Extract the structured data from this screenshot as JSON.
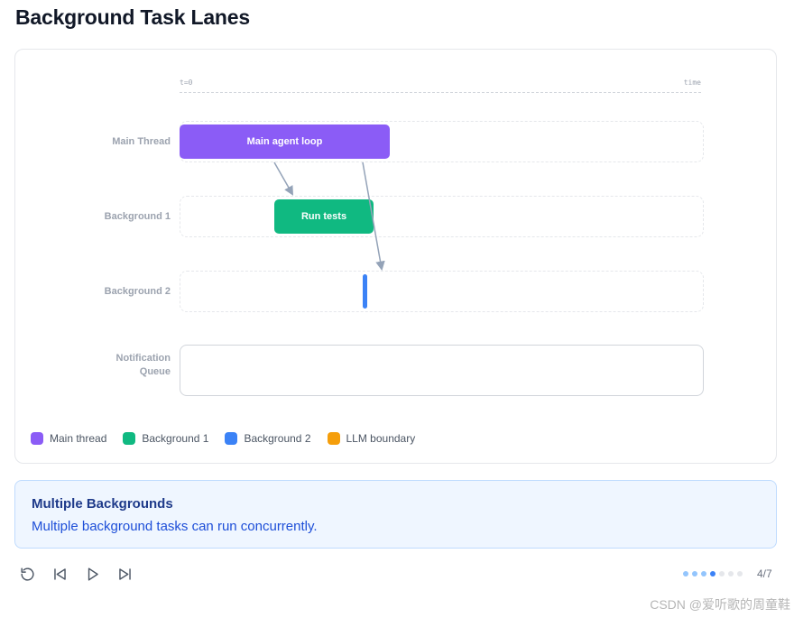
{
  "page": {
    "title": "Background Task Lanes"
  },
  "timeline": {
    "start_label": "t=0",
    "end_label": "time"
  },
  "lanes": [
    {
      "label": "Main Thread"
    },
    {
      "label": "Background 1"
    },
    {
      "label": "Background 2"
    },
    {
      "label": "Notification\nQueue"
    }
  ],
  "tasks": {
    "main": "Main agent loop",
    "bg1": "Run tests"
  },
  "legend": [
    {
      "label": "Main thread",
      "color": "#8b5cf6"
    },
    {
      "label": "Background 1",
      "color": "#10b981"
    },
    {
      "label": "Background 2",
      "color": "#3b82f6"
    },
    {
      "label": "LLM boundary",
      "color": "#f59e0b"
    }
  ],
  "info": {
    "title": "Multiple Backgrounds",
    "text": "Multiple background tasks can run concurrently."
  },
  "controls": {
    "reset": "reset-icon",
    "prev": "skip-back-icon",
    "play": "play-icon",
    "next": "skip-forward-icon"
  },
  "progress": {
    "current": 4,
    "total": 7,
    "label": "4/7"
  },
  "watermark": "CSDN @爱听歌的周童鞋"
}
